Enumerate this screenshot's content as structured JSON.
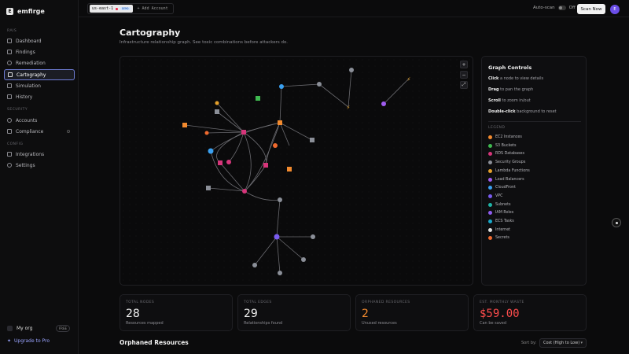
{
  "brand": {
    "name": "emfirge"
  },
  "sidebar": {
    "sections": [
      {
        "label": "RAIS",
        "items": [
          {
            "label": "Dashboard",
            "icon": "grid-icon"
          },
          {
            "label": "Findings",
            "icon": "flag-icon"
          },
          {
            "label": "Remediation",
            "icon": "shield-icon"
          },
          {
            "label": "Cartography",
            "icon": "map-icon",
            "active": true
          },
          {
            "label": "Simulation",
            "icon": "bolt-icon"
          },
          {
            "label": "History",
            "icon": "pulse-icon"
          }
        ]
      },
      {
        "label": "SECURITY",
        "items": [
          {
            "label": "Accounts",
            "icon": "globe-icon"
          },
          {
            "label": "Compliance",
            "icon": "check-icon"
          }
        ]
      },
      {
        "label": "CONFIG",
        "items": [
          {
            "label": "Integrations",
            "icon": "plug-icon"
          },
          {
            "label": "Settings",
            "icon": "gear-icon"
          }
        ]
      }
    ],
    "org": {
      "name": "My org",
      "badge": "FREE"
    },
    "upgrade": "Upgrade to Pro"
  },
  "topbar": {
    "account": "us-east-1",
    "account_tag": "DEMO",
    "add_account": "+ Add Account",
    "autoscan_label": "Auto-scan",
    "autoscan_state": "Off",
    "scan_button": "Scan Now",
    "user_initial": "E"
  },
  "page": {
    "title": "Cartography",
    "subtitle": "Infrastructure relationship graph. See toxic combinations before attackers do."
  },
  "graph": {
    "zoom_in": "+",
    "zoom_out": "−",
    "fit": "⤢"
  },
  "controls": {
    "title": "Graph Controls",
    "lines": [
      {
        "key": "Click",
        "text": " a node to view details"
      },
      {
        "key": "Drag",
        "text": " to pan the graph"
      },
      {
        "key": "Scroll",
        "text": " to zoom in/out"
      },
      {
        "key": "Double-click",
        "text": " background to reset"
      }
    ],
    "legend_title": "LEGEND",
    "legend": [
      {
        "label": "EC2 Instances",
        "color": "#f28a2e"
      },
      {
        "label": "S3 Buckets",
        "color": "#3fb950"
      },
      {
        "label": "RDS Databases",
        "color": "#d6357a"
      },
      {
        "label": "Security Groups",
        "color": "#8b8f98"
      },
      {
        "label": "Lambda Functions",
        "color": "#e3a02c"
      },
      {
        "label": "Load Balancers",
        "color": "#a05cf0"
      },
      {
        "label": "CloudFront",
        "color": "#3aa0f0"
      },
      {
        "label": "VPC",
        "color": "#7a5cf0"
      },
      {
        "label": "Subnets",
        "color": "#1fb3a6"
      },
      {
        "label": "IAM Roles",
        "color": "#8f5cf0"
      },
      {
        "label": "ECS Tasks",
        "color": "#18a8c9"
      },
      {
        "label": "Internet",
        "color": "#e0e0e0"
      },
      {
        "label": "Secrets",
        "color": "#f06a2e"
      }
    ]
  },
  "stats": [
    {
      "label": "TOTAL NODES",
      "value": "28",
      "sub": "Resources mapped",
      "tone": ""
    },
    {
      "label": "TOTAL EDGES",
      "value": "29",
      "sub": "Relationships found",
      "tone": ""
    },
    {
      "label": "ORPHANED RESOURCES",
      "value": "2",
      "sub": "Unused resources",
      "tone": "orange"
    },
    {
      "label": "EST. MONTHLY WASTE",
      "value": "$59.00",
      "sub": "Can be saved",
      "tone": "red"
    }
  ],
  "orphaned": {
    "title": "Orphaned Resources",
    "sort_label": "Sort by:",
    "sort_value": "Cost (High to Low)"
  }
}
